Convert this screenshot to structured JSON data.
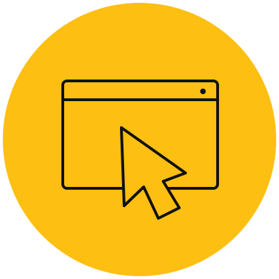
{
  "colors": {
    "background": "#ffffff",
    "circle": "#fdbf12",
    "stroke": "#111111"
  },
  "icons": {
    "badge": "circle-badge",
    "window": "browser-window-icon",
    "cursor": "mouse-cursor-arrow-icon"
  }
}
